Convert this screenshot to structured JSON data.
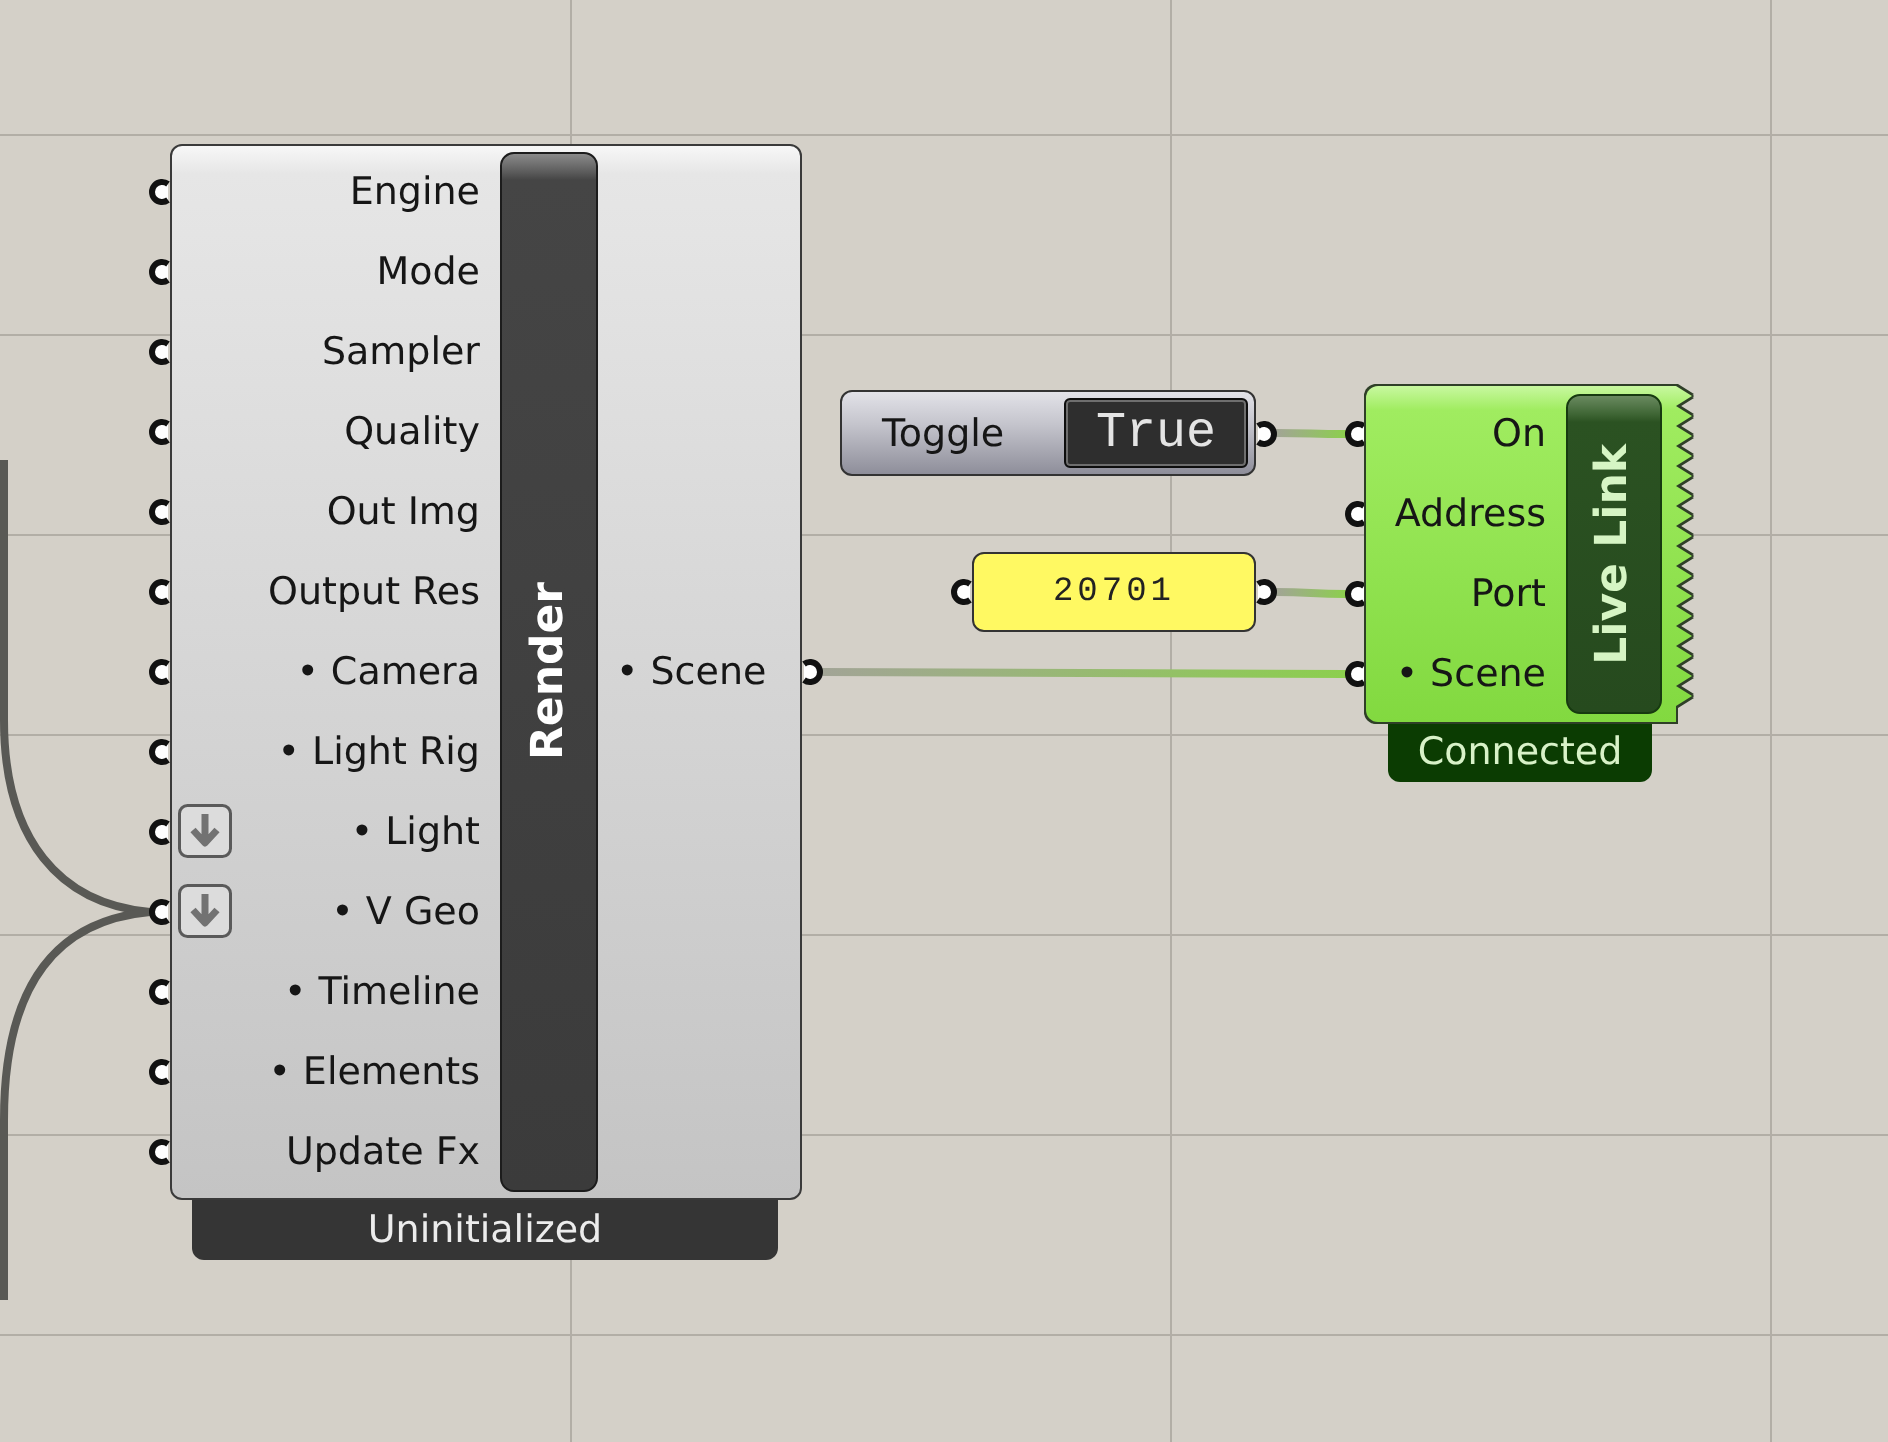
{
  "nodes": [
    {
      "kind": "component",
      "title": "Render",
      "selected": false,
      "inputs": [
        {
          "label": "Engine",
          "arrow_button": false,
          "connected": false
        },
        {
          "label": "Mode",
          "arrow_button": false,
          "connected": false
        },
        {
          "label": "Sampler",
          "arrow_button": false,
          "connected": false
        },
        {
          "label": "Quality",
          "arrow_button": false,
          "connected": false
        },
        {
          "label": "Out Img",
          "arrow_button": false,
          "connected": false
        },
        {
          "label": "Output Res",
          "arrow_button": false,
          "connected": false
        },
        {
          "label": "• Camera",
          "arrow_button": false,
          "connected": false
        },
        {
          "label": "• Light Rig",
          "arrow_button": false,
          "connected": false
        },
        {
          "label": "• Light",
          "arrow_button": true,
          "connected": false
        },
        {
          "label": "• V Geo",
          "arrow_button": true,
          "connected": true
        },
        {
          "label": "• Timeline",
          "arrow_button": false,
          "connected": false
        },
        {
          "label": "• Elements",
          "arrow_button": false,
          "connected": false
        },
        {
          "label": "Update Fx",
          "arrow_button": false,
          "connected": false
        }
      ],
      "outputs": [
        {
          "label": "• Scene"
        }
      ],
      "status": "Uninitialized"
    },
    {
      "kind": "toggle",
      "label": "Toggle",
      "value": "True",
      "selected": false
    },
    {
      "kind": "panel",
      "value": "20701",
      "selected": false
    },
    {
      "kind": "component",
      "title": "Live Link",
      "selected": true,
      "inputs": [
        {
          "label": "On",
          "arrow_button": false,
          "connected": true
        },
        {
          "label": "Address",
          "arrow_button": false,
          "connected": false
        },
        {
          "label": "Port",
          "arrow_button": false,
          "connected": true
        },
        {
          "label": "• Scene",
          "arrow_button": false,
          "connected": true
        }
      ],
      "status": "Connected"
    }
  ]
}
